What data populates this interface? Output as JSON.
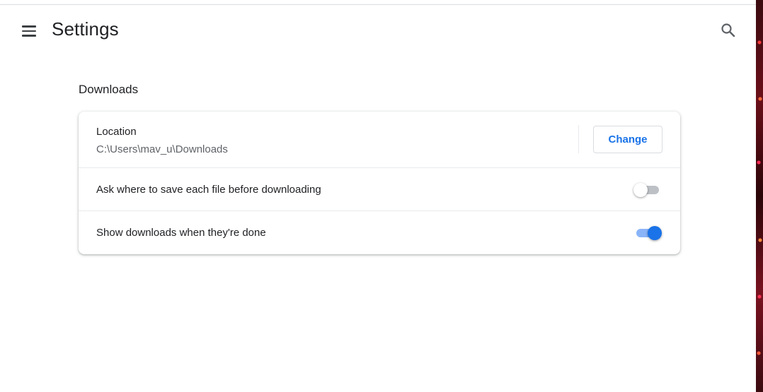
{
  "header": {
    "title": "Settings",
    "menu_icon": "hamburger-menu-icon",
    "search_icon": "search-icon"
  },
  "section": {
    "title": "Downloads"
  },
  "location": {
    "label": "Location",
    "path": "C:\\Users\\mav_u\\Downloads",
    "change_label": "Change"
  },
  "settings": [
    {
      "label": "Ask where to save each file before downloading",
      "enabled": false
    },
    {
      "label": "Show downloads when they're done",
      "enabled": true
    }
  ],
  "colors": {
    "accent": "#1a73e8",
    "toggle_on_track": "#8ab4f8",
    "toggle_off_track": "#bdc1c6"
  }
}
